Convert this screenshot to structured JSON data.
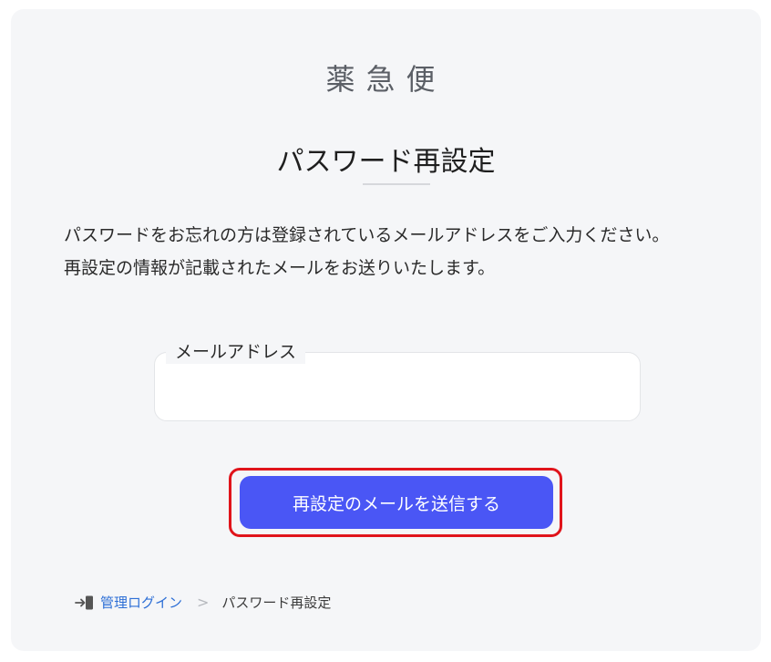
{
  "header": {
    "logo_text": "薬急便",
    "page_title": "パスワード再設定"
  },
  "description": {
    "line1": "パスワードをお忘れの方は登録されているメールアドレスをご入力ください。",
    "line2": "再設定の情報が記載されたメールをお送りいたします。"
  },
  "form": {
    "email_label": "メールアドレス",
    "email_value": "",
    "submit_label": "再設定のメールを送信する"
  },
  "breadcrumb": {
    "icon": "login-icon",
    "link_label": "管理ログイン",
    "separator": ">",
    "current": "パスワード再設定"
  },
  "colors": {
    "accent": "#4a56f5",
    "link": "#2d6fd6",
    "highlight_border": "#e0141b",
    "card_background": "#f5f6f8"
  }
}
